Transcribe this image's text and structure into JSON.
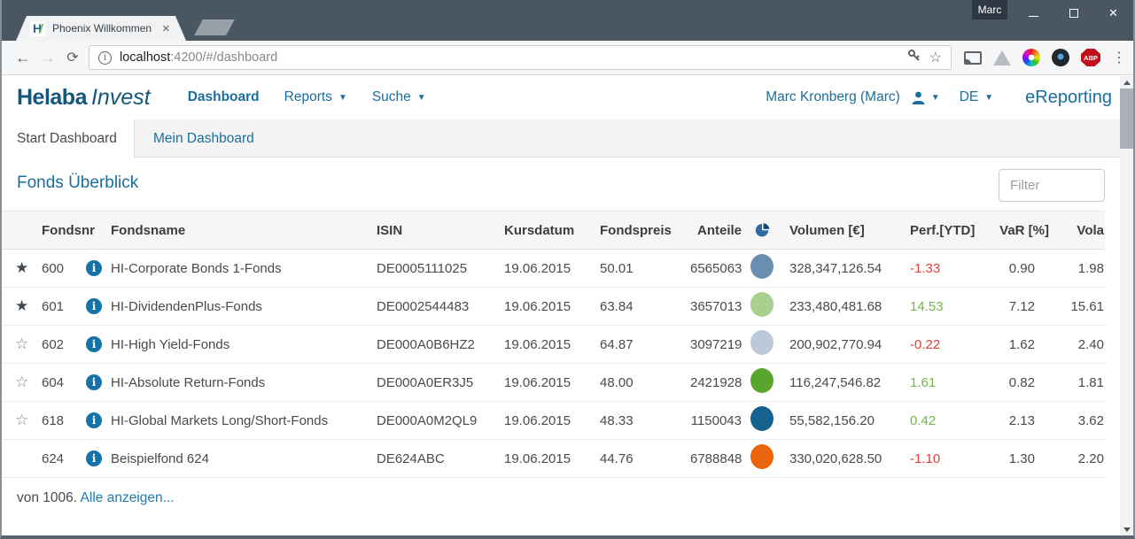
{
  "window": {
    "profile_label": "Marc"
  },
  "browser_tab": {
    "title": "Phoenix Willkommen",
    "favicon_letter": "H",
    "favicon_slash": "/",
    "close_glyph": "✕"
  },
  "toolbar": {
    "url_host": "localhost",
    "url_rest": ":4200/#/dashboard",
    "adblock_badge": "ABP"
  },
  "app_header": {
    "logo_primary": "Helaba",
    "logo_secondary": "Invest",
    "nav": [
      {
        "label": "Dashboard"
      },
      {
        "label": "Reports"
      },
      {
        "label": "Suche"
      }
    ],
    "user": "Marc Kronberg (Marc)",
    "language": "DE",
    "product": "eReporting"
  },
  "dashboard_tabs": [
    {
      "label": "Start Dashboard"
    },
    {
      "label": "Mein Dashboard"
    }
  ],
  "panel": {
    "title": "Fonds Überblick",
    "filter_placeholder": "Filter",
    "footer_text": "von 1006.",
    "footer_link": "Alle anzeigen..."
  },
  "table": {
    "headers": {
      "fondsnr": "Fondsnr",
      "fondsname": "Fondsname",
      "isin": "ISIN",
      "kursdatum": "Kursdatum",
      "fondspreis": "Fondspreis",
      "anteile": "Anteile",
      "volumen": "Volumen [€]",
      "perf": "Perf.[YTD]",
      "var": "VaR [%]",
      "vola": "Vola"
    },
    "accent_blue": "#1b6e9c",
    "perf_negative_color": "#e2403a",
    "perf_positive_color": "#74b648",
    "rows": [
      {
        "star": "★",
        "star_style": "color:#3f4a55",
        "fondsnr": "600",
        "name": "HI-Corporate Bonds 1-Fonds",
        "isin": "DE0005111025",
        "date": "19.06.2015",
        "price": "50.01",
        "shares": "6565063",
        "dot_style": "background:#6b8eb0",
        "volume": "328,347,126.54",
        "perf": "-1.33",
        "perf_style": "color:#e2403a",
        "var": "0.90",
        "vola": "1.98"
      },
      {
        "star": "★",
        "star_style": "color:#3f4a55",
        "fondsnr": "601",
        "name": "HI-DividendenPlus-Fonds",
        "isin": "DE0002544483",
        "date": "19.06.2015",
        "price": "63.84",
        "shares": "3657013",
        "dot_style": "background:#a9cf8e",
        "volume": "233,480,481.68",
        "perf": "14.53",
        "perf_style": "color:#74b648",
        "var": "7.12",
        "vola": "15.61"
      },
      {
        "star": "☆",
        "star_style": "color:#7e858c",
        "fondsnr": "602",
        "name": "HI-High Yield-Fonds",
        "isin": "DE000A0B6HZ2",
        "date": "19.06.2015",
        "price": "64.87",
        "shares": "3097219",
        "dot_style": "background:#bcc9da",
        "volume": "200,902,770.94",
        "perf": "-0.22",
        "perf_style": "color:#e2403a",
        "var": "1.62",
        "vola": "2.40"
      },
      {
        "star": "☆",
        "star_style": "color:#7e858c",
        "fondsnr": "604",
        "name": "HI-Absolute Return-Fonds",
        "isin": "DE000A0ER3J5",
        "date": "19.06.2015",
        "price": "48.00",
        "shares": "2421928",
        "dot_style": "background:#58a62d",
        "volume": "116,247,546.82",
        "perf": "1.61",
        "perf_style": "color:#74b648",
        "var": "0.82",
        "vola": "1.81"
      },
      {
        "star": "☆",
        "star_style": "color:#7e858c",
        "fondsnr": "618",
        "name": "HI-Global Markets Long/Short-Fonds",
        "isin": "DE000A0M2QL9",
        "date": "19.06.2015",
        "price": "48.33",
        "shares": "1150043",
        "dot_style": "background:#15628e",
        "volume": "55,582,156.20",
        "perf": "0.42",
        "perf_style": "color:#74b648",
        "var": "2.13",
        "vola": "3.62"
      },
      {
        "star": "",
        "star_style": "",
        "fondsnr": "624",
        "name": "Beispielfond 624",
        "isin": "DE624ABC",
        "date": "19.06.2015",
        "price": "44.76",
        "shares": "6788848",
        "dot_style": "background:#e8650d",
        "volume": "330,020,628.50",
        "perf": "-1.10",
        "perf_style": "color:#e2403a",
        "var": "1.30",
        "vola": "2.20"
      }
    ]
  }
}
